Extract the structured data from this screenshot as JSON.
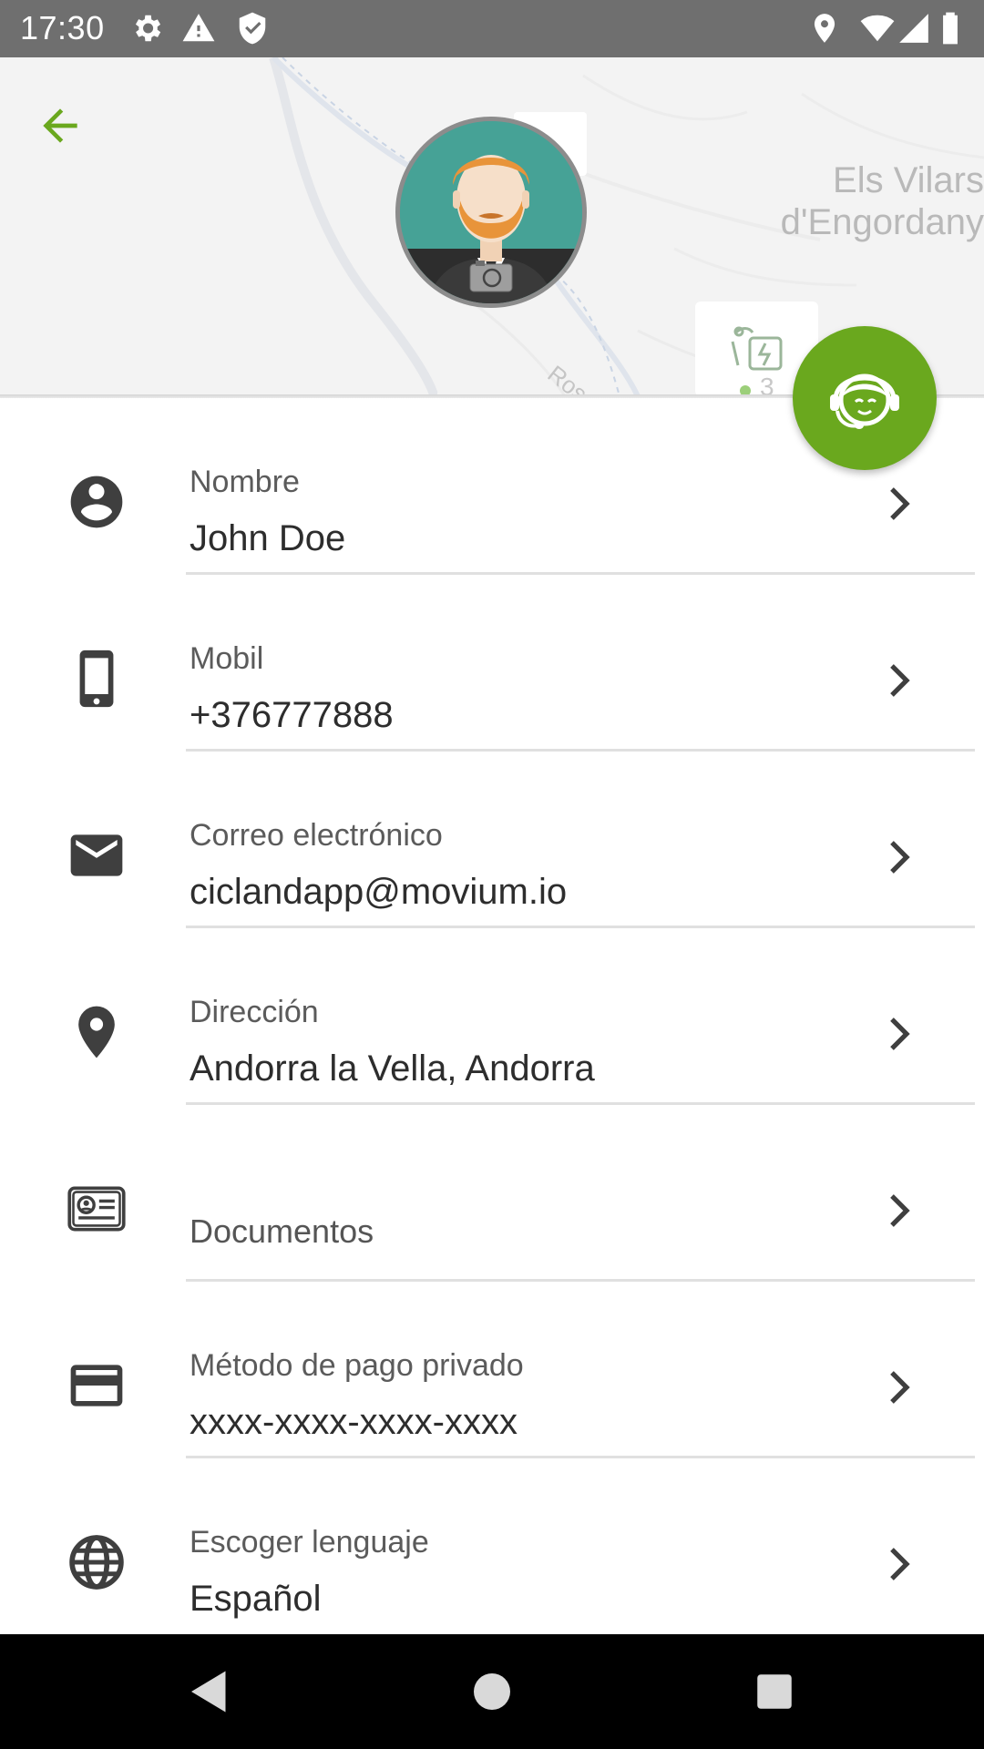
{
  "status_bar": {
    "time": "17:30",
    "left_icons": [
      "gear-icon",
      "warning-icon",
      "shield-icon"
    ],
    "right_icons": [
      "location-icon",
      "wifi-icon",
      "signal-icon",
      "battery-icon"
    ]
  },
  "map": {
    "town_line1": "Els Vilars",
    "town_line2": "d'Engordany",
    "street_name": "Rossell",
    "station_count": "3"
  },
  "header": {
    "back_icon": "arrow-back-icon",
    "avatar_icon": "avatar-bearded-man",
    "camera_icon": "camera-icon",
    "support_icon": "headset-support-icon"
  },
  "profile_items": [
    {
      "icon": "account-circle-icon",
      "label": "Nombre",
      "value": "John Doe"
    },
    {
      "icon": "smartphone-icon",
      "label": "Mobil",
      "value": "+376777888"
    },
    {
      "icon": "email-icon",
      "label": "Correo electrónico",
      "value": "ciclandapp@movium.io"
    },
    {
      "icon": "location-pin-icon",
      "label": "Dirección",
      "value": "Andorra la Vella, Andorra"
    },
    {
      "icon": "id-card-icon",
      "label": "Documentos"
    },
    {
      "icon": "credit-card-icon",
      "label": "Método de pago privado",
      "value": "xxxx-xxxx-xxxx-xxxx"
    },
    {
      "icon": "globe-icon",
      "label": "Escoger lenguaje",
      "value": "Español"
    }
  ],
  "nav_bar": [
    "back-triangle-icon",
    "home-circle-icon",
    "recents-square-icon"
  ],
  "colors": {
    "accent": "#6aa81e",
    "status_bar": "#6f6f6f",
    "icon": "#3f3f3f"
  }
}
